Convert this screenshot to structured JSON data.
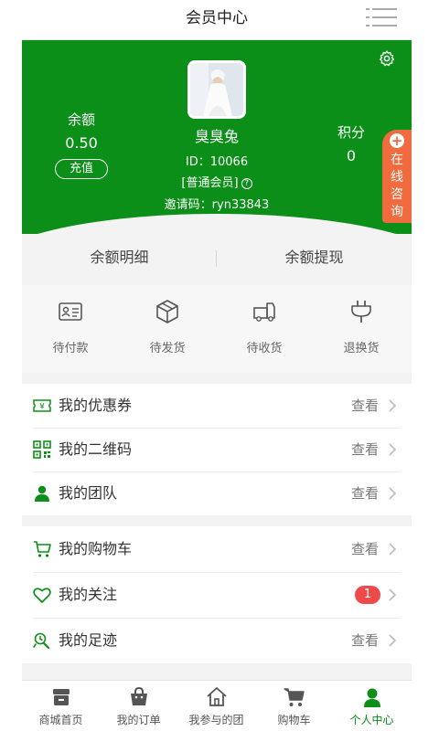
{
  "header": {
    "title": "会员中心",
    "menu_icon": "menu-icon"
  },
  "profile": {
    "balance_label": "余额",
    "balance_value": "0.50",
    "recharge_label": "充值",
    "name": "臭臭兔",
    "id_text": "ID：10066",
    "level_text": "[普通会员]",
    "help_glyph": "?",
    "invite_text": "邀请码：ryn33843",
    "points_label": "积分",
    "points_value": "0",
    "settings_icon": "gear-icon"
  },
  "online_service": {
    "plus": "+",
    "label": "在线咨询"
  },
  "balance_tabs": [
    "余额明细",
    "余额提现"
  ],
  "order_status": [
    {
      "label": "待付款",
      "icon": "id-card-icon"
    },
    {
      "label": "待发货",
      "icon": "package-icon"
    },
    {
      "label": "待收货",
      "icon": "truck-icon"
    },
    {
      "label": "退换货",
      "icon": "plug-icon"
    }
  ],
  "menu_group_1": [
    {
      "label": "我的优惠券",
      "action": "查看",
      "icon": "coupon-icon"
    },
    {
      "label": "我的二维码",
      "action": "查看",
      "icon": "qrcode-icon"
    },
    {
      "label": "我的团队",
      "action": "查看",
      "icon": "user-icon"
    }
  ],
  "menu_group_2": [
    {
      "label": "我的购物车",
      "action": "查看",
      "icon": "cart-icon"
    },
    {
      "label": "我的关注",
      "badge": "1",
      "icon": "heart-icon"
    },
    {
      "label": "我的足迹",
      "action": "查看",
      "icon": "footprint-icon"
    }
  ],
  "bottom_nav": [
    {
      "label": "商城首页",
      "icon": "store-icon"
    },
    {
      "label": "我的订单",
      "icon": "bag-icon"
    },
    {
      "label": "我参与的团",
      "icon": "home-icon"
    },
    {
      "label": "购物车",
      "icon": "cart-icon"
    },
    {
      "label": "个人中心",
      "icon": "person-icon",
      "active": true
    }
  ],
  "colors": {
    "brand_green": "#0b8f18",
    "accent_orange": "#f06b3d",
    "badge_red": "#ef4a4a"
  }
}
